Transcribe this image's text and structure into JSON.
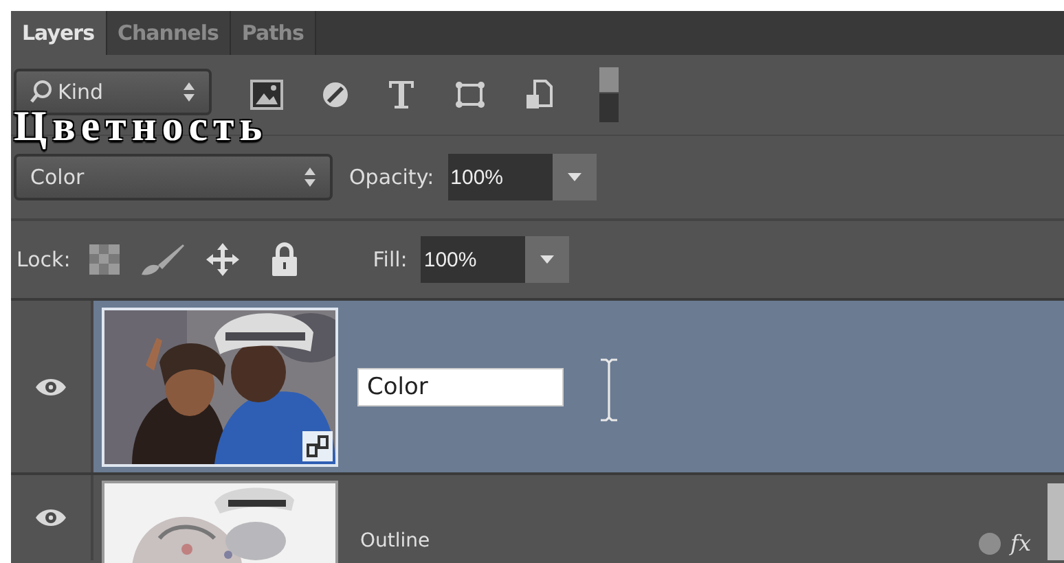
{
  "tabs": [
    {
      "label": "Layers",
      "selected": true
    },
    {
      "label": "Channels",
      "selected": false
    },
    {
      "label": "Paths",
      "selected": false
    }
  ],
  "filter": {
    "label": "Kind"
  },
  "caption": "Цветность",
  "blend_mode": {
    "value": "Color"
  },
  "opacity": {
    "label": "Opacity:",
    "value": "100%"
  },
  "lock": {
    "label": "Lock:"
  },
  "fill": {
    "label": "Fill:",
    "value": "100%"
  },
  "layers": [
    {
      "name": "Color",
      "visible": true,
      "selected": true,
      "editing": true,
      "smart_object": true
    },
    {
      "name": "Outline",
      "visible": true,
      "selected": false,
      "editing": false,
      "smart_object": false,
      "effects_label": "fx"
    }
  ]
}
